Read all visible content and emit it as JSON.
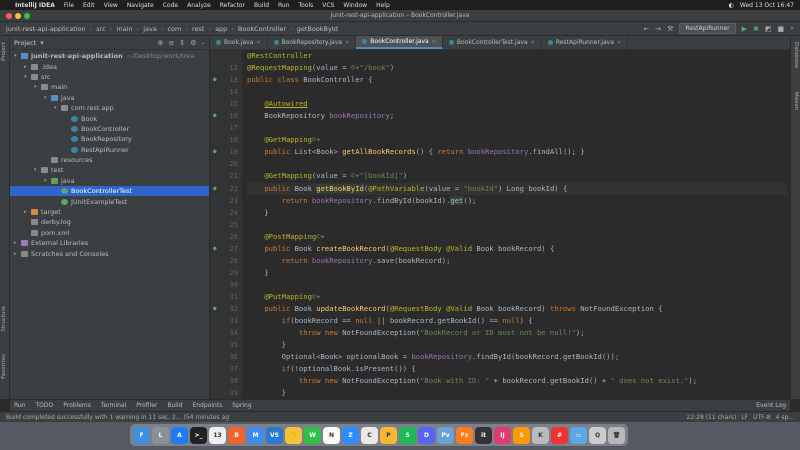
{
  "menubar": {
    "app": "IntelliJ IDEA",
    "items": [
      "File",
      "Edit",
      "View",
      "Navigate",
      "Code",
      "Analyze",
      "Refactor",
      "Build",
      "Run",
      "Tools",
      "VCS",
      "Window",
      "Help"
    ],
    "datetime": "Wed 13 Oct 16:47"
  },
  "window_title": "junit-rest-api-application – BookController.java",
  "breadcrumbs": [
    "junit-rest-api-application",
    "src",
    "main",
    "java",
    "com",
    "rest",
    "app",
    "BookController",
    "getBookById"
  ],
  "run_config": "RestApiRunner",
  "project_panel": {
    "title": "Project",
    "tree": [
      {
        "depth": 0,
        "arrow": "▾",
        "icon": "folder-blue",
        "label": "junit-rest-api-application",
        "hint": "~/Desktop/work/trea",
        "bold": true
      },
      {
        "depth": 1,
        "arrow": "▸",
        "icon": "folder",
        "label": ".idea"
      },
      {
        "depth": 1,
        "arrow": "▾",
        "icon": "folder",
        "label": "src"
      },
      {
        "depth": 2,
        "arrow": "▾",
        "icon": "folder",
        "label": "main"
      },
      {
        "depth": 3,
        "arrow": "▾",
        "icon": "folder-blue",
        "label": "java"
      },
      {
        "depth": 4,
        "arrow": "▾",
        "icon": "folder",
        "label": "com.rest.app"
      },
      {
        "depth": 5,
        "arrow": "",
        "icon": "class",
        "label": "Book"
      },
      {
        "depth": 5,
        "arrow": "",
        "icon": "class",
        "label": "BookController"
      },
      {
        "depth": 5,
        "arrow": "",
        "icon": "class",
        "label": "BookRepository"
      },
      {
        "depth": 5,
        "arrow": "",
        "icon": "class",
        "label": "RestApiRunner"
      },
      {
        "depth": 3,
        "arrow": "",
        "icon": "folder",
        "label": "resources"
      },
      {
        "depth": 2,
        "arrow": "▾",
        "icon": "folder",
        "label": "test"
      },
      {
        "depth": 3,
        "arrow": "▾",
        "icon": "folder-green",
        "label": "java"
      },
      {
        "depth": 4,
        "arrow": "",
        "icon": "test",
        "label": "BookControllerTest",
        "selected": true
      },
      {
        "depth": 4,
        "arrow": "",
        "icon": "test",
        "label": "JUnitExampleTest"
      },
      {
        "depth": 1,
        "arrow": "▸",
        "icon": "folder-orange",
        "label": "target"
      },
      {
        "depth": 1,
        "arrow": "",
        "icon": "file",
        "label": "derby.log"
      },
      {
        "depth": 1,
        "arrow": "",
        "icon": "file",
        "label": "pom.xml"
      },
      {
        "depth": 0,
        "arrow": "▸",
        "icon": "lib",
        "label": "External Libraries"
      },
      {
        "depth": 0,
        "arrow": "▸",
        "icon": "file",
        "label": "Scratches and Consoles"
      }
    ]
  },
  "left_tool_tabs": [
    "Project",
    "Structure",
    "Favorites"
  ],
  "right_tool_tabs": [
    "Database",
    "Maven"
  ],
  "editor_tabs": [
    {
      "label": "Book.java",
      "active": false
    },
    {
      "label": "BookRepository.java",
      "active": false
    },
    {
      "label": "BookController.java",
      "active": true
    },
    {
      "label": "BookControllerTest.java",
      "active": false
    },
    {
      "label": "RestApiRunner.java",
      "active": false
    }
  ],
  "code_lines": [
    {
      "n": "",
      "mark": "",
      "html": "<span class=\"ann\">@RestController</span>"
    },
    {
      "n": "12",
      "mark": "",
      "html": "<span class=\"ann\">@RequestMapping</span>(value = <span class=\"str\">©▾\"/book\"</span>)"
    },
    {
      "n": "13",
      "mark": "●",
      "html": "<span class=\"kw\">public class</span> BookController {"
    },
    {
      "n": "14",
      "mark": "",
      "html": ""
    },
    {
      "n": "15",
      "mark": "",
      "html": "    <span class=\"ann ul\">@Autowired</span>"
    },
    {
      "n": "16",
      "mark": "●",
      "html": "    BookRepository <span class=\"fld\">bookRepository</span>;"
    },
    {
      "n": "17",
      "mark": "",
      "html": ""
    },
    {
      "n": "18",
      "mark": "",
      "html": "    <span class=\"ann\">@GetMapping</span><span class=\"str\">©▾</span>"
    },
    {
      "n": "19",
      "mark": "●",
      "html": "    <span class=\"kw\">public</span> List&lt;Book&gt; <span class=\"fn\">getAllBookRecords</span>() { <span class=\"kw\">return</span> <span class=\"fld\">bookRepository</span>.findAll(); }"
    },
    {
      "n": "20",
      "mark": "",
      "html": ""
    },
    {
      "n": "21",
      "mark": "",
      "html": "    <span class=\"ann\">@GetMapping</span>(value = <span class=\"str\">©▾\"[bookId]\"</span>)"
    },
    {
      "n": "22",
      "mark": "●",
      "cur": true,
      "html": "    <span class=\"kw\">public</span> Book <span class=\"fn hl\">getBookById</span>(<span class=\"ann\">@PathVariable</span>(value = <span class=\"str\">\"bookId\"</span>) Long bookId) {"
    },
    {
      "n": "23",
      "mark": "",
      "html": "        <span class=\"kw\">return</span> <span class=\"fld\">bookRepository</span>.findById(bookId).<span class=\"hl\">get</span>();"
    },
    {
      "n": "24",
      "mark": "",
      "html": "    }"
    },
    {
      "n": "25",
      "mark": "",
      "html": ""
    },
    {
      "n": "26",
      "mark": "",
      "html": "    <span class=\"ann\">@PostMapping</span><span class=\"str\">©▾</span>"
    },
    {
      "n": "27",
      "mark": "●",
      "html": "    <span class=\"kw\">public</span> Book <span class=\"fn\">createBookRecord</span>(<span class=\"ann\">@RequestBody</span> <span class=\"ann\">@Valid</span> Book bookRecord) {"
    },
    {
      "n": "28",
      "mark": "",
      "html": "        <span class=\"kw\">return</span> <span class=\"fld\">bookRepository</span>.save(bookRecord);"
    },
    {
      "n": "29",
      "mark": "",
      "html": "    }"
    },
    {
      "n": "30",
      "mark": "",
      "html": ""
    },
    {
      "n": "31",
      "mark": "",
      "html": "    <span class=\"ann\">@PutMapping</span><span class=\"str\">©▾</span>"
    },
    {
      "n": "32",
      "mark": "●",
      "html": "    <span class=\"kw\">public</span> Book <span class=\"fn\">updateBookRecord</span>(<span class=\"ann\">@RequestBody</span> <span class=\"ann\">@Valid</span> Book bookRecord) <span class=\"kw\">throws</span> NotFoundException {"
    },
    {
      "n": "33",
      "mark": "",
      "html": "        <span class=\"kw\">if</span>(bookRecord == <span class=\"kw\">null</span> || bookRecord.getBookId() == <span class=\"kw\">null</span>) {"
    },
    {
      "n": "34",
      "mark": "",
      "html": "            <span class=\"kw\">throw new</span> NotFoundException(<span class=\"str\">\"BookRecord or ID must not be null!\"</span>);"
    },
    {
      "n": "35",
      "mark": "",
      "html": "        }"
    },
    {
      "n": "36",
      "mark": "",
      "html": "        Optional&lt;Book&gt; optionalBook = <span class=\"fld\">bookRepository</span>.findById(bookRecord.getBookId());"
    },
    {
      "n": "37",
      "mark": "",
      "html": "        <span class=\"kw\">if</span>(!optionalBook.isPresent()) {"
    },
    {
      "n": "38",
      "mark": "",
      "html": "            <span class=\"kw\">throw new</span> NotFoundException(<span class=\"str\">\"Book with ID: \"</span> + bookRecord.getBookId() + <span class=\"str\">\" does not exist.\"</span>);"
    },
    {
      "n": "39",
      "mark": "",
      "html": "        }"
    }
  ],
  "bottom_tools": [
    "Run",
    "TODO",
    "Problems",
    "Terminal",
    "Profiler",
    "Build",
    "Endpoints",
    "Spring"
  ],
  "event_log": "Event Log",
  "status": {
    "message": "Build completed successfully with 1 warning in 11 sec, 2... (54 minutes ag",
    "position": "22:28 (11 chars)",
    "line_sep": "LF",
    "encoding": "UTF-8",
    "indent": "4 sp..."
  },
  "dock": [
    {
      "name": "finder",
      "label": "F",
      "color": "#3d8fe0"
    },
    {
      "name": "launchpad",
      "label": "L",
      "color": "#8a8f9a"
    },
    {
      "name": "appstore",
      "label": "A",
      "color": "#1e7cf2"
    },
    {
      "name": "terminal",
      "label": ">_",
      "color": "#222"
    },
    {
      "name": "calendar",
      "label": "13",
      "color": "#eee"
    },
    {
      "name": "brave",
      "label": "B",
      "color": "#f0642a"
    },
    {
      "name": "mail",
      "label": "M",
      "color": "#3b8ef0"
    },
    {
      "name": "vscode",
      "label": "VS",
      "color": "#2a7ad0"
    },
    {
      "name": "hand",
      "label": "✋",
      "color": "#f3c235"
    },
    {
      "name": "whatsapp",
      "label": "W",
      "color": "#30c04a"
    },
    {
      "name": "notion",
      "label": "N",
      "color": "#fafafa"
    },
    {
      "name": "zoom",
      "label": "Z",
      "color": "#2d8cff"
    },
    {
      "name": "chrome",
      "label": "C",
      "color": "#e9e9e9"
    },
    {
      "name": "photos",
      "label": "P",
      "color": "#f7b733"
    },
    {
      "name": "spotify",
      "label": "S",
      "color": "#1db954"
    },
    {
      "name": "discord",
      "label": "D",
      "color": "#5865f2"
    },
    {
      "name": "preview",
      "label": "Pv",
      "color": "#6aa1d8"
    },
    {
      "name": "firefox",
      "label": "Fx",
      "color": "#ff7a1a"
    },
    {
      "name": "iterm",
      "label": "it",
      "color": "#333"
    },
    {
      "name": "intellij",
      "label": "IJ",
      "color": "#e23a6e"
    },
    {
      "name": "sublime",
      "label": "S",
      "color": "#ff9800"
    },
    {
      "name": "slides",
      "label": "K",
      "color": "#bbb"
    },
    {
      "name": "mosaic",
      "label": "#",
      "color": "#e33"
    },
    {
      "name": "folder",
      "label": "▭",
      "color": "#5aa9e6"
    },
    {
      "name": "search",
      "label": "Q",
      "color": "#ccc"
    },
    {
      "name": "trash",
      "label": "🗑",
      "color": "#b8b8b8"
    }
  ]
}
